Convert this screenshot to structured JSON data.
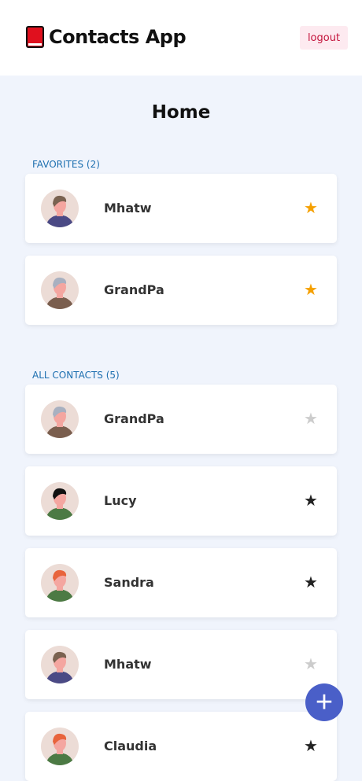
{
  "header": {
    "app_title": "Contacts App",
    "logo_icon": "red-book-icon",
    "logout_label": "logout"
  },
  "page_title": "Home",
  "favorites": {
    "label": "FAVORITES (2)",
    "items": [
      {
        "name": "Mhatw",
        "starred": true,
        "avatar": {
          "hair": "#7a6250",
          "body": "#4b4a85"
        }
      },
      {
        "name": "GrandPa",
        "starred": true,
        "avatar": {
          "hair": "#a8b0c0",
          "body": "#7a5e4e"
        }
      }
    ]
  },
  "all_contacts": {
    "label": "ALL CONTACTS (5)",
    "items": [
      {
        "name": "GrandPa",
        "starred": false,
        "avatar": {
          "hair": "#a8b0c0",
          "body": "#7a5e4e"
        }
      },
      {
        "name": "Lucy",
        "starred": true,
        "avatar": {
          "hair": "#111111",
          "body": "#4c7a44"
        }
      },
      {
        "name": "Sandra",
        "starred": true,
        "avatar": {
          "hair": "#e8643c",
          "body": "#4c7a44"
        }
      },
      {
        "name": "Mhatw",
        "starred": false,
        "avatar": {
          "hair": "#7a6250",
          "body": "#4b4a85"
        }
      },
      {
        "name": "Claudia",
        "starred": true,
        "avatar": {
          "hair": "#e8643c",
          "body": "#4c7a44"
        }
      }
    ]
  },
  "colors": {
    "star_favorite": "#f5a000",
    "star_dark": "#222222",
    "star_off": "#cccccc",
    "fab": "#4a5fc8"
  },
  "fab": {
    "label": "+",
    "icon": "plus-icon"
  }
}
